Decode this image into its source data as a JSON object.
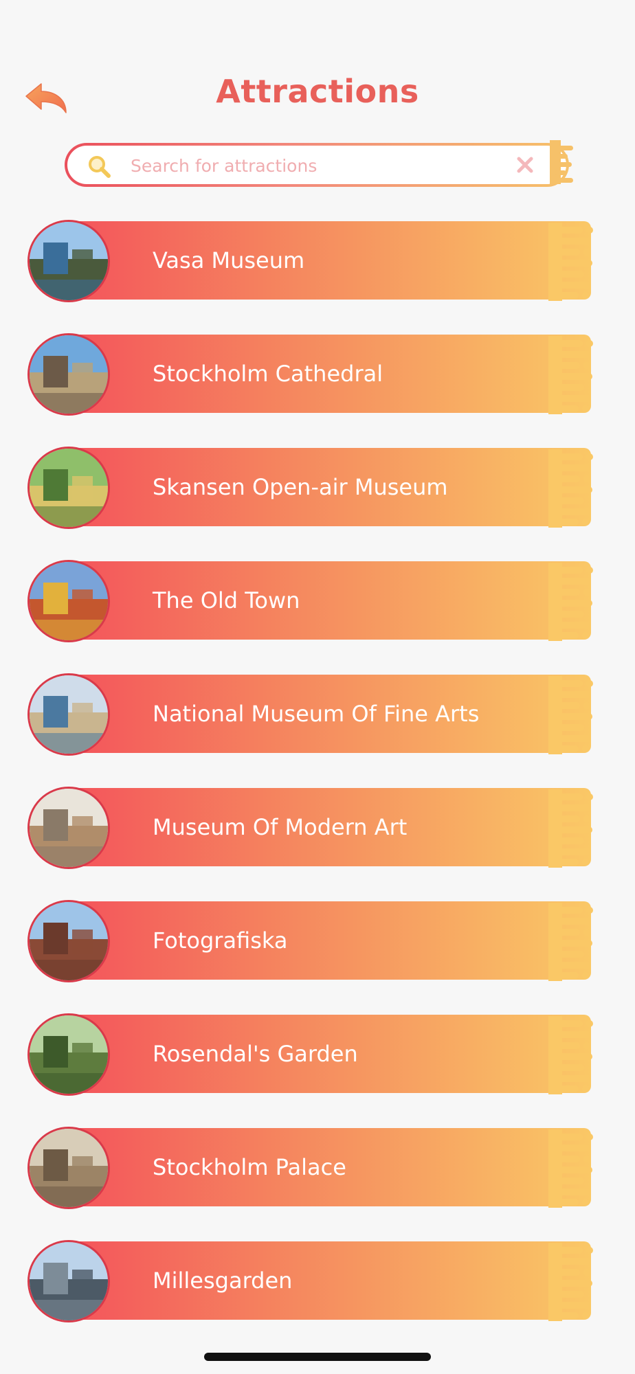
{
  "header": {
    "title": "Attractions",
    "back_icon": "back-arrow-icon"
  },
  "search": {
    "placeholder": "Search for attractions",
    "value": "",
    "icon": "search-icon",
    "clear_icon": "close-icon"
  },
  "attractions": [
    {
      "name": "Vasa Museum"
    },
    {
      "name": "Stockholm Cathedral"
    },
    {
      "name": "Skansen Open-air Museum"
    },
    {
      "name": "The Old Town"
    },
    {
      "name": "National Museum Of Fine Arts"
    },
    {
      "name": "Museum Of Modern Art"
    },
    {
      "name": "Fotografiska"
    },
    {
      "name": "Rosendal's Garden"
    },
    {
      "name": "Stockholm Palace"
    },
    {
      "name": "Millesgarden"
    }
  ],
  "colors": {
    "accent": "#e8605a",
    "gradient_start": "#f4545b",
    "gradient_end": "#fac866",
    "border": "#d93a4a",
    "background": "#f7f7f7"
  }
}
